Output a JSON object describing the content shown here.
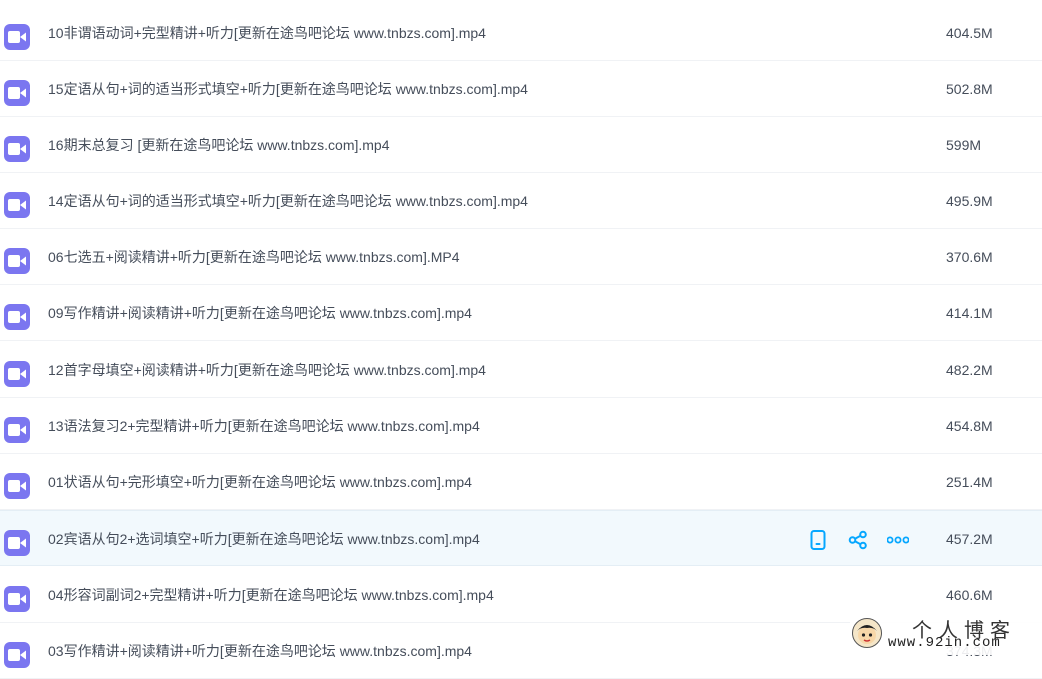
{
  "files": [
    {
      "name": "10非谓语动词+完型精讲+听力[更新在途鸟吧论坛 www.tnbzs.com].mp4",
      "size": "404.5M"
    },
    {
      "name": "15定语从句+词的适当形式填空+听力[更新在途鸟吧论坛 www.tnbzs.com].mp4",
      "size": "502.8M"
    },
    {
      "name": "16期末总复习 [更新在途鸟吧论坛 www.tnbzs.com].mp4",
      "size": "599M"
    },
    {
      "name": "14定语从句+词的适当形式填空+听力[更新在途鸟吧论坛 www.tnbzs.com].mp4",
      "size": "495.9M"
    },
    {
      "name": "06七选五+阅读精讲+听力[更新在途鸟吧论坛 www.tnbzs.com].MP4",
      "size": "370.6M"
    },
    {
      "name": "09写作精讲+阅读精讲+听力[更新在途鸟吧论坛 www.tnbzs.com].mp4",
      "size": "414.1M"
    },
    {
      "name": "12首字母填空+阅读精讲+听力[更新在途鸟吧论坛 www.tnbzs.com].mp4",
      "size": "482.2M"
    },
    {
      "name": "13语法复习2+完型精讲+听力[更新在途鸟吧论坛 www.tnbzs.com].mp4",
      "size": "454.8M"
    },
    {
      "name": "01状语从句+完形填空+听力[更新在途鸟吧论坛 www.tnbzs.com].mp4",
      "size": "251.4M"
    },
    {
      "name": "02宾语从句2+选词填空+听力[更新在途鸟吧论坛 www.tnbzs.com].mp4",
      "size": "457.2M"
    },
    {
      "name": "04形容词副词2+完型精讲+听力[更新在途鸟吧论坛 www.tnbzs.com].mp4",
      "size": "460.6M"
    },
    {
      "name": "03写作精讲+阅读精讲+听力[更新在途鸟吧论坛 www.tnbzs.com].mp4",
      "size": "374.3M"
    }
  ],
  "hovered_row_actions": [
    "phone-icon",
    "share-icon",
    "more-icon"
  ],
  "accent_color": "#06a7ff",
  "file_icon_color": "#7b76f0",
  "watermark": {
    "title": "个人博客",
    "url": "www.92in.com"
  }
}
